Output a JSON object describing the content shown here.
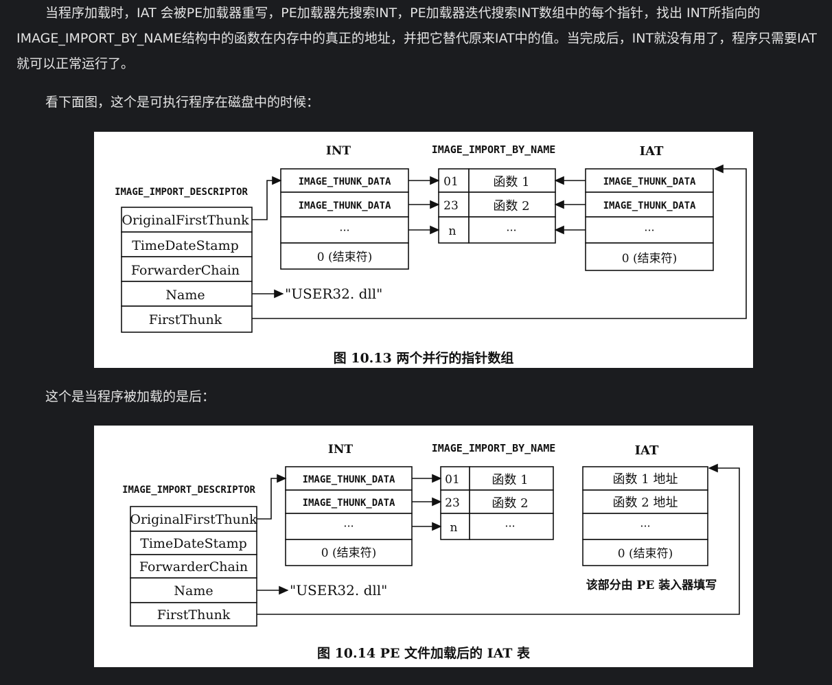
{
  "article": {
    "paragraph1": "当程序加载时，IAT 会被PE加载器重写，PE加载器先搜索INT，PE加载器迭代搜索INT数组中的每个指针，找出 INT所指向的IMAGE_IMPORT_BY_NAME结构中的函数在内存中的真正的地址，并把它替代原来IAT中的值。当完成后，INT就没有用了，程序只需要IAT就可以正常运行了。",
    "paragraph2": "看下面图，这个是可执行程序在磁盘中的时候：",
    "paragraph3": "这个是当程序被加载的是后："
  },
  "figure1": {
    "int_title": "INT",
    "ibn_title": "IMAGE_IMPORT_BY_NAME",
    "iat_title": "IAT",
    "descriptor_title": "IMAGE_IMPORT_DESCRIPTOR",
    "descriptor_fields": [
      "OriginalFirstThunk",
      "TimeDateStamp",
      "ForwarderChain",
      "Name",
      "FirstThunk"
    ],
    "int_rows": [
      "IMAGE_THUNK_DATA",
      "IMAGE_THUNK_DATA",
      "···",
      "0 (结束符)"
    ],
    "ibn_hints": [
      "01",
      "23",
      "n"
    ],
    "ibn_names": [
      "函数 1",
      "函数 2",
      "···"
    ],
    "iat_rows": [
      "IMAGE_THUNK_DATA",
      "IMAGE_THUNK_DATA",
      "···",
      "0 (结束符)"
    ],
    "dll_name": "\"USER32. dll\"",
    "caption": "图 10.13   两个并行的指针数组"
  },
  "figure2": {
    "int_title": "INT",
    "ibn_title": "IMAGE_IMPORT_BY_NAME",
    "iat_title": "IAT",
    "descriptor_title": "IMAGE_IMPORT_DESCRIPTOR",
    "descriptor_fields": [
      "OriginalFirstThunk",
      "TimeDateStamp",
      "ForwarderChain",
      "Name",
      "FirstThunk"
    ],
    "int_rows": [
      "IMAGE_THUNK_DATA",
      "IMAGE_THUNK_DATA",
      "···",
      "0 (结束符)"
    ],
    "ibn_hints": [
      "01",
      "23",
      "n"
    ],
    "ibn_names": [
      "函数 1",
      "函数 2",
      "···"
    ],
    "iat_rows": [
      "函数 1 地址",
      "函数 2 地址",
      "···",
      "0 (结束符)"
    ],
    "iat_note": "该部分由 PE 装入器填写",
    "dll_name": "\"USER32. dll\"",
    "caption": "图 10.14   PE 文件加载后的 IAT 表"
  }
}
